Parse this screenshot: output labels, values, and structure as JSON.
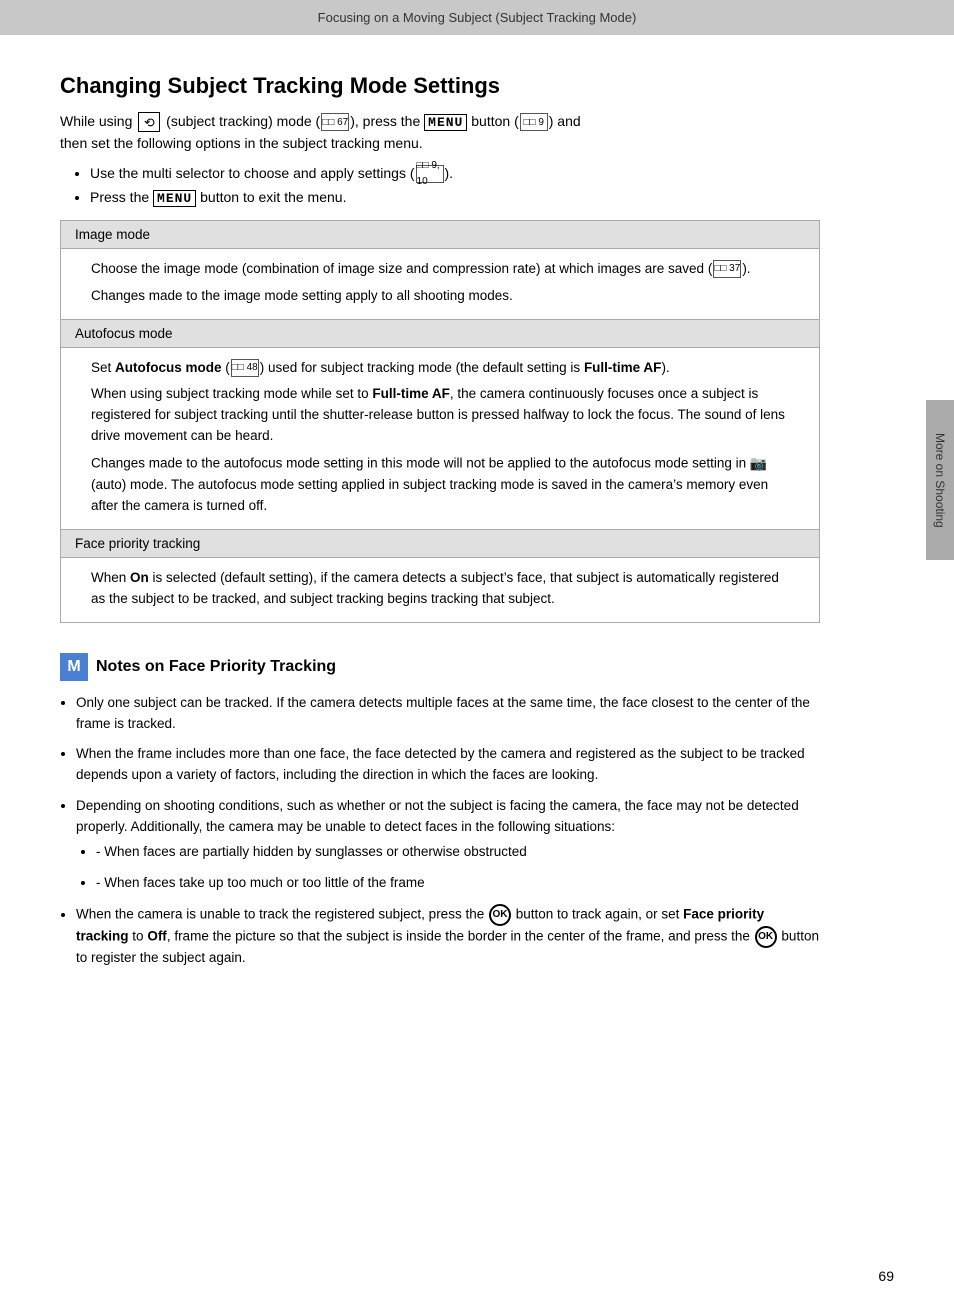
{
  "header": {
    "title": "Focusing on a Moving Subject (Subject Tracking Mode)"
  },
  "page_title": "Changing Subject Tracking Mode Settings",
  "intro": {
    "line1_before": "While using",
    "line1_icon": "subject-tracking-icon",
    "line1_middle": "(subject tracking) mode (",
    "line1_ref1": "67",
    "line1_after1": "), press the",
    "line1_menu": "MENU",
    "line1_button": "button (",
    "line1_ref2": "9",
    "line1_and": ") and",
    "line1_then": "then set the following options in the subject tracking menu."
  },
  "bullets": [
    {
      "text": "Use the multi selector to choose and apply settings (",
      "ref": "9, 10",
      "text2": ")."
    },
    {
      "text_before": "Press the",
      "menu": "MENU",
      "text_after": "button to exit the menu."
    }
  ],
  "table": {
    "rows": [
      {
        "header": "Image mode",
        "content": [
          "Choose the image mode (combination of image size and compression rate) at which images are saved (□□ 37).",
          "Changes made to the image mode setting apply to all shooting modes."
        ]
      },
      {
        "header": "Autofocus mode",
        "content_parts": [
          {
            "type": "bold_inline",
            "before": "Set ",
            "bold": "Autofocus mode",
            "ref": "48",
            "after": " used for subject tracking mode (the default setting is "
          },
          {
            "type": "bold_end",
            "bold": "Full-time AF",
            "after": ")."
          },
          {
            "type": "bold_inline",
            "before": "When using subject tracking mode while set to ",
            "bold": "Full-time AF",
            "after": ", the camera continuously focuses once a subject is registered for subject tracking until the shutter-release button is pressed halfway to lock the focus. The sound of lens drive movement can be heard."
          },
          {
            "type": "text",
            "text": "Changes made to the autofocus mode setting in this mode will not be applied to the autofocus mode setting in 📷 (auto) mode. The autofocus mode setting applied in subject tracking mode is saved in the camera’s memory even after the camera is turned off."
          }
        ]
      },
      {
        "header": "Face priority tracking",
        "content_parts": [
          {
            "type": "bold_inline",
            "before": "When ",
            "bold": "On",
            "after": " is selected (default setting), if the camera detects a subject’s face, that subject is automatically registered as the subject to be tracked, and subject tracking begins tracking that subject."
          }
        ]
      }
    ]
  },
  "notes": {
    "icon_text": "M",
    "title": "Notes on Face Priority Tracking",
    "items": [
      {
        "text": "Only one subject can be tracked. If the camera detects multiple faces at the same time, the face closest to the center of the frame is tracked."
      },
      {
        "text": "When the frame includes more than one face, the face detected by the camera and registered as the subject to be tracked depends upon a variety of factors, including the direction in which the faces are looking."
      },
      {
        "text": "Depending on shooting conditions, such as whether or not the subject is facing the camera, the face may not be detected properly. Additionally, the camera may be unable to detect faces in the following situations:",
        "sub_items": [
          "When faces are partially hidden by sunglasses or otherwise obstructed",
          "When faces take up too much or too little of the frame"
        ]
      },
      {
        "text_before": "When the camera is unable to track the registered subject, press the",
        "ok_icon": "OK",
        "text_middle": "button to track again, or set",
        "bold": "Face priority tracking",
        "text_after1": "to ",
        "bold2": "Off",
        "text_after2": ", frame the picture so that the subject is inside the border in the center of the frame, and press the",
        "ok_icon2": "OK",
        "text_end": "button to register the subject again."
      }
    ]
  },
  "right_tab": {
    "text": "More on Shooting"
  },
  "page_number": "69"
}
